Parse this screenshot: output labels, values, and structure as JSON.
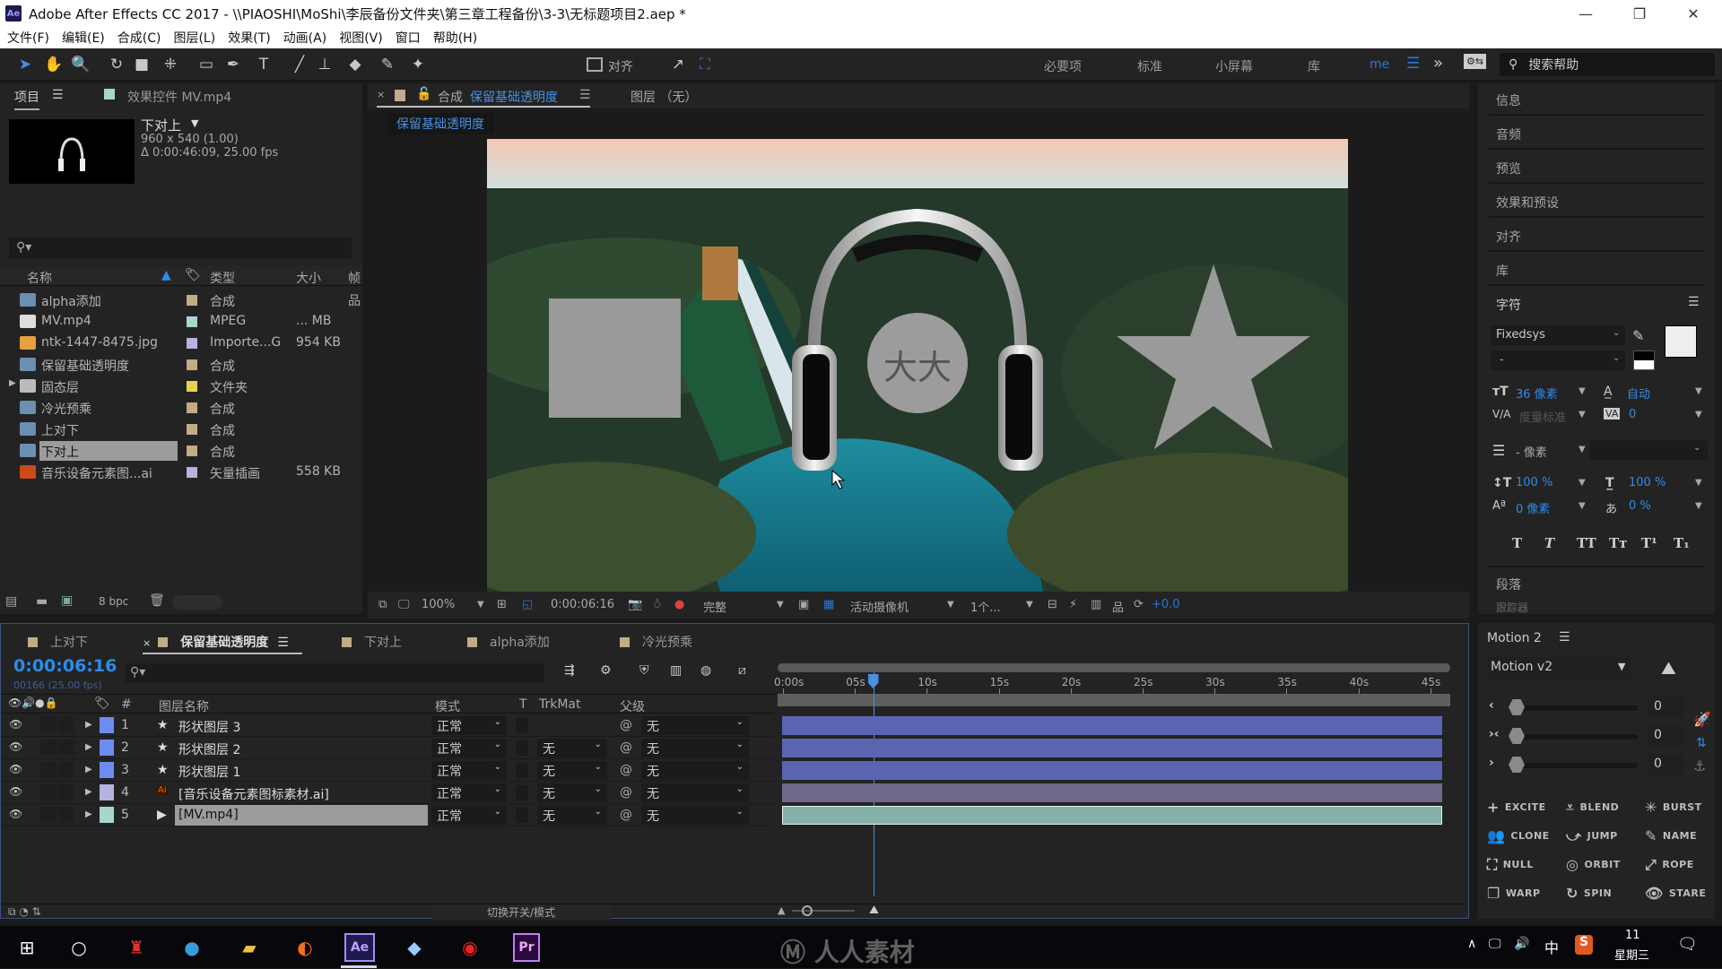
{
  "window": {
    "title": "Adobe After Effects CC 2017 - \\\\PIAOSHI\\MoShi\\李辰备份文件夹\\第三章工程备份\\3-3\\无标题项目2.aep *",
    "app_badge": "Ae",
    "controls": {
      "minimize": "—",
      "maximize": "❐",
      "close": "✕"
    }
  },
  "menu": [
    "文件(F)",
    "编辑(E)",
    "合成(C)",
    "图层(L)",
    "效果(T)",
    "动画(A)",
    "视图(V)",
    "窗口",
    "帮助(H)"
  ],
  "toolbar": {
    "tools": [
      {
        "name": "selection-tool",
        "glyph": "➤"
      },
      {
        "name": "hand-tool",
        "glyph": "✋"
      },
      {
        "name": "zoom-tool",
        "glyph": "🔍"
      },
      {
        "name": "rotate-tool",
        "glyph": "↻"
      },
      {
        "name": "camera-tool",
        "glyph": "■"
      },
      {
        "name": "pan-behind-tool",
        "glyph": "⁜"
      },
      {
        "name": "rectangle-tool",
        "glyph": "▭"
      },
      {
        "name": "pen-tool",
        "glyph": "✒"
      },
      {
        "name": "type-tool",
        "glyph": "T"
      },
      {
        "name": "brush-tool",
        "glyph": "╱"
      },
      {
        "name": "clone-stamp-tool",
        "glyph": "⊥"
      },
      {
        "name": "eraser-tool",
        "glyph": "◆"
      },
      {
        "name": "roto-brush-tool",
        "glyph": "✎"
      },
      {
        "name": "puppet-pin-tool",
        "glyph": "✦"
      }
    ],
    "align_label": "对齐",
    "workspaces": [
      "必要项",
      "标准",
      "小屏幕",
      "库"
    ],
    "active_workspace": "me",
    "search_help_placeholder": "搜索帮助"
  },
  "project_panel": {
    "tab_project": "项目",
    "tab_effects": "效果控件 MV.mp4",
    "selected_item": {
      "name": "下对上",
      "resolution": "960 x 540 (1.00)",
      "duration": "Δ 0:00:46:09, 25.00 fps"
    },
    "search_placeholder": "",
    "columns": {
      "name": "名称",
      "type": "类型",
      "size": "大小",
      "extra": "帧"
    },
    "items": [
      {
        "name": "alpha添加",
        "type": "合成",
        "size": "",
        "kind": "comp",
        "label": "#c2ab87"
      },
      {
        "name": "MV.mp4",
        "type": "MPEG",
        "size": "... MB",
        "kind": "video",
        "label": "#a7d6cd"
      },
      {
        "name": "ntk-1447-8475.jpg",
        "type": "Importe...G",
        "size": "954 KB",
        "kind": "image",
        "label": "#b6b3e0"
      },
      {
        "name": "保留基础透明度",
        "type": "合成",
        "size": "",
        "kind": "comp",
        "label": "#c2ab87"
      },
      {
        "name": "固态层",
        "type": "文件夹",
        "size": "",
        "kind": "folder",
        "label": "#e8d44a"
      },
      {
        "name": "冷光预乘",
        "type": "合成",
        "size": "",
        "kind": "comp",
        "label": "#c2ab87"
      },
      {
        "name": "上对下",
        "type": "合成",
        "size": "",
        "kind": "comp",
        "label": "#c2ab87"
      },
      {
        "name": "下对上",
        "type": "合成",
        "size": "",
        "kind": "comp",
        "label": "#c2ab87",
        "selected": true
      },
      {
        "name": "音乐设备元素图...ai",
        "type": "矢量插画",
        "size": "558 KB",
        "kind": "ai",
        "label": "#b6b3e0"
      }
    ],
    "bit_depth": "8 bpc"
  },
  "composition": {
    "tab_prefix": "合成",
    "tab_name": "保留基础透明度",
    "layer_tab": "图层 （无）",
    "breadcrumb": "保留基础透明度",
    "canvas_text": "大大",
    "viewer_bar": {
      "zoom": "100%",
      "timecode": "0:00:06:16",
      "resolution": "完整",
      "camera": "活动摄像机",
      "views": "1个...",
      "exposure": "+0.0"
    }
  },
  "right_panel": {
    "sections": [
      "信息",
      "音频",
      "预览",
      "效果和预设",
      "对齐",
      "库"
    ],
    "character": {
      "title": "字符",
      "font": "Fixedsys",
      "style": "-",
      "font_size": "36 像素",
      "leading": "自动",
      "kerning": "度量标准",
      "tracking": "0",
      "stroke": "- 像素",
      "vertical_scale": "100 %",
      "horizontal_scale": "100 %",
      "baseline_shift": "0 像素",
      "tsume": "0 %",
      "styles": [
        "T",
        "T",
        "TT",
        "Tт",
        "T¹",
        "T₁"
      ]
    },
    "paragraph": "段落",
    "tracker": "跟踪器"
  },
  "timeline": {
    "tabs": [
      {
        "label": "上对下",
        "active": false
      },
      {
        "label": "保留基础透明度",
        "active": true
      },
      {
        "label": "下对上",
        "active": false
      },
      {
        "label": "alpha添加",
        "active": false
      },
      {
        "label": "冷光预乘",
        "active": false
      }
    ],
    "current_time": "0:00:06:16",
    "frame_info": "00166 (25.00 fps)",
    "columns": {
      "num": "#",
      "layer_name": "图层名称",
      "mode": "模式",
      "t": "T",
      "trkmat": "TrkMat",
      "parent": "父级"
    },
    "layers": [
      {
        "num": "1",
        "name": "形状图层 3",
        "kind": "shape",
        "label": "#6c8df0",
        "mode": "正常",
        "trkmat": "",
        "parent": "无",
        "bar": "#5b64b0"
      },
      {
        "num": "2",
        "name": "形状图层 2",
        "kind": "shape",
        "label": "#6c8df0",
        "mode": "正常",
        "trkmat": "无",
        "parent": "无",
        "bar": "#5b64b0"
      },
      {
        "num": "3",
        "name": "形状图层 1",
        "kind": "shape",
        "label": "#6c8df0",
        "mode": "正常",
        "trkmat": "无",
        "parent": "无",
        "bar": "#5b64b0"
      },
      {
        "num": "4",
        "name": "[音乐设备元素图标素材.ai]",
        "kind": "ai",
        "label": "#b6b3e0",
        "mode": "正常",
        "trkmat": "无",
        "parent": "无",
        "bar": "#6d6a8c"
      },
      {
        "num": "5",
        "name": "[MV.mp4]",
        "kind": "video",
        "label": "#a7d6cd",
        "mode": "正常",
        "trkmat": "无",
        "parent": "无",
        "bar": "#86b1aa",
        "selected": true
      }
    ],
    "ruler": [
      "0:00s",
      "05s",
      "10s",
      "15s",
      "20s",
      "25s",
      "30s",
      "35s",
      "40s",
      "45s"
    ],
    "duration_seconds": 46.36,
    "playhead_seconds": 6.64,
    "toggle_label": "切换开关/模式"
  },
  "motion_panel": {
    "title": "Motion 2",
    "preset": "Motion v2",
    "sliders": [
      {
        "icon": "‹",
        "value": "0"
      },
      {
        "icon": "›‹",
        "value": "0"
      },
      {
        "icon": "›",
        "value": "0"
      }
    ],
    "buttons": [
      {
        "label": "EXCITE",
        "glyph": "+"
      },
      {
        "label": "BLEND",
        "glyph": "⩡"
      },
      {
        "label": "BURST",
        "glyph": "✳"
      },
      {
        "label": "CLONE",
        "glyph": "👥"
      },
      {
        "label": "JUMP",
        "glyph": "⤻"
      },
      {
        "label": "NAME",
        "glyph": "✎"
      },
      {
        "label": "NULL",
        "glyph": "⛶"
      },
      {
        "label": "ORBIT",
        "glyph": "◎"
      },
      {
        "label": "ROPE",
        "glyph": "⤢"
      },
      {
        "label": "WARP",
        "glyph": "❐"
      },
      {
        "label": "SPIN",
        "glyph": "↻"
      },
      {
        "label": "STARE",
        "glyph": "👁"
      }
    ]
  },
  "taskbar": {
    "watermark": "人人素材",
    "clock_time": "11",
    "clock_day": "星期三",
    "ime": "中"
  }
}
